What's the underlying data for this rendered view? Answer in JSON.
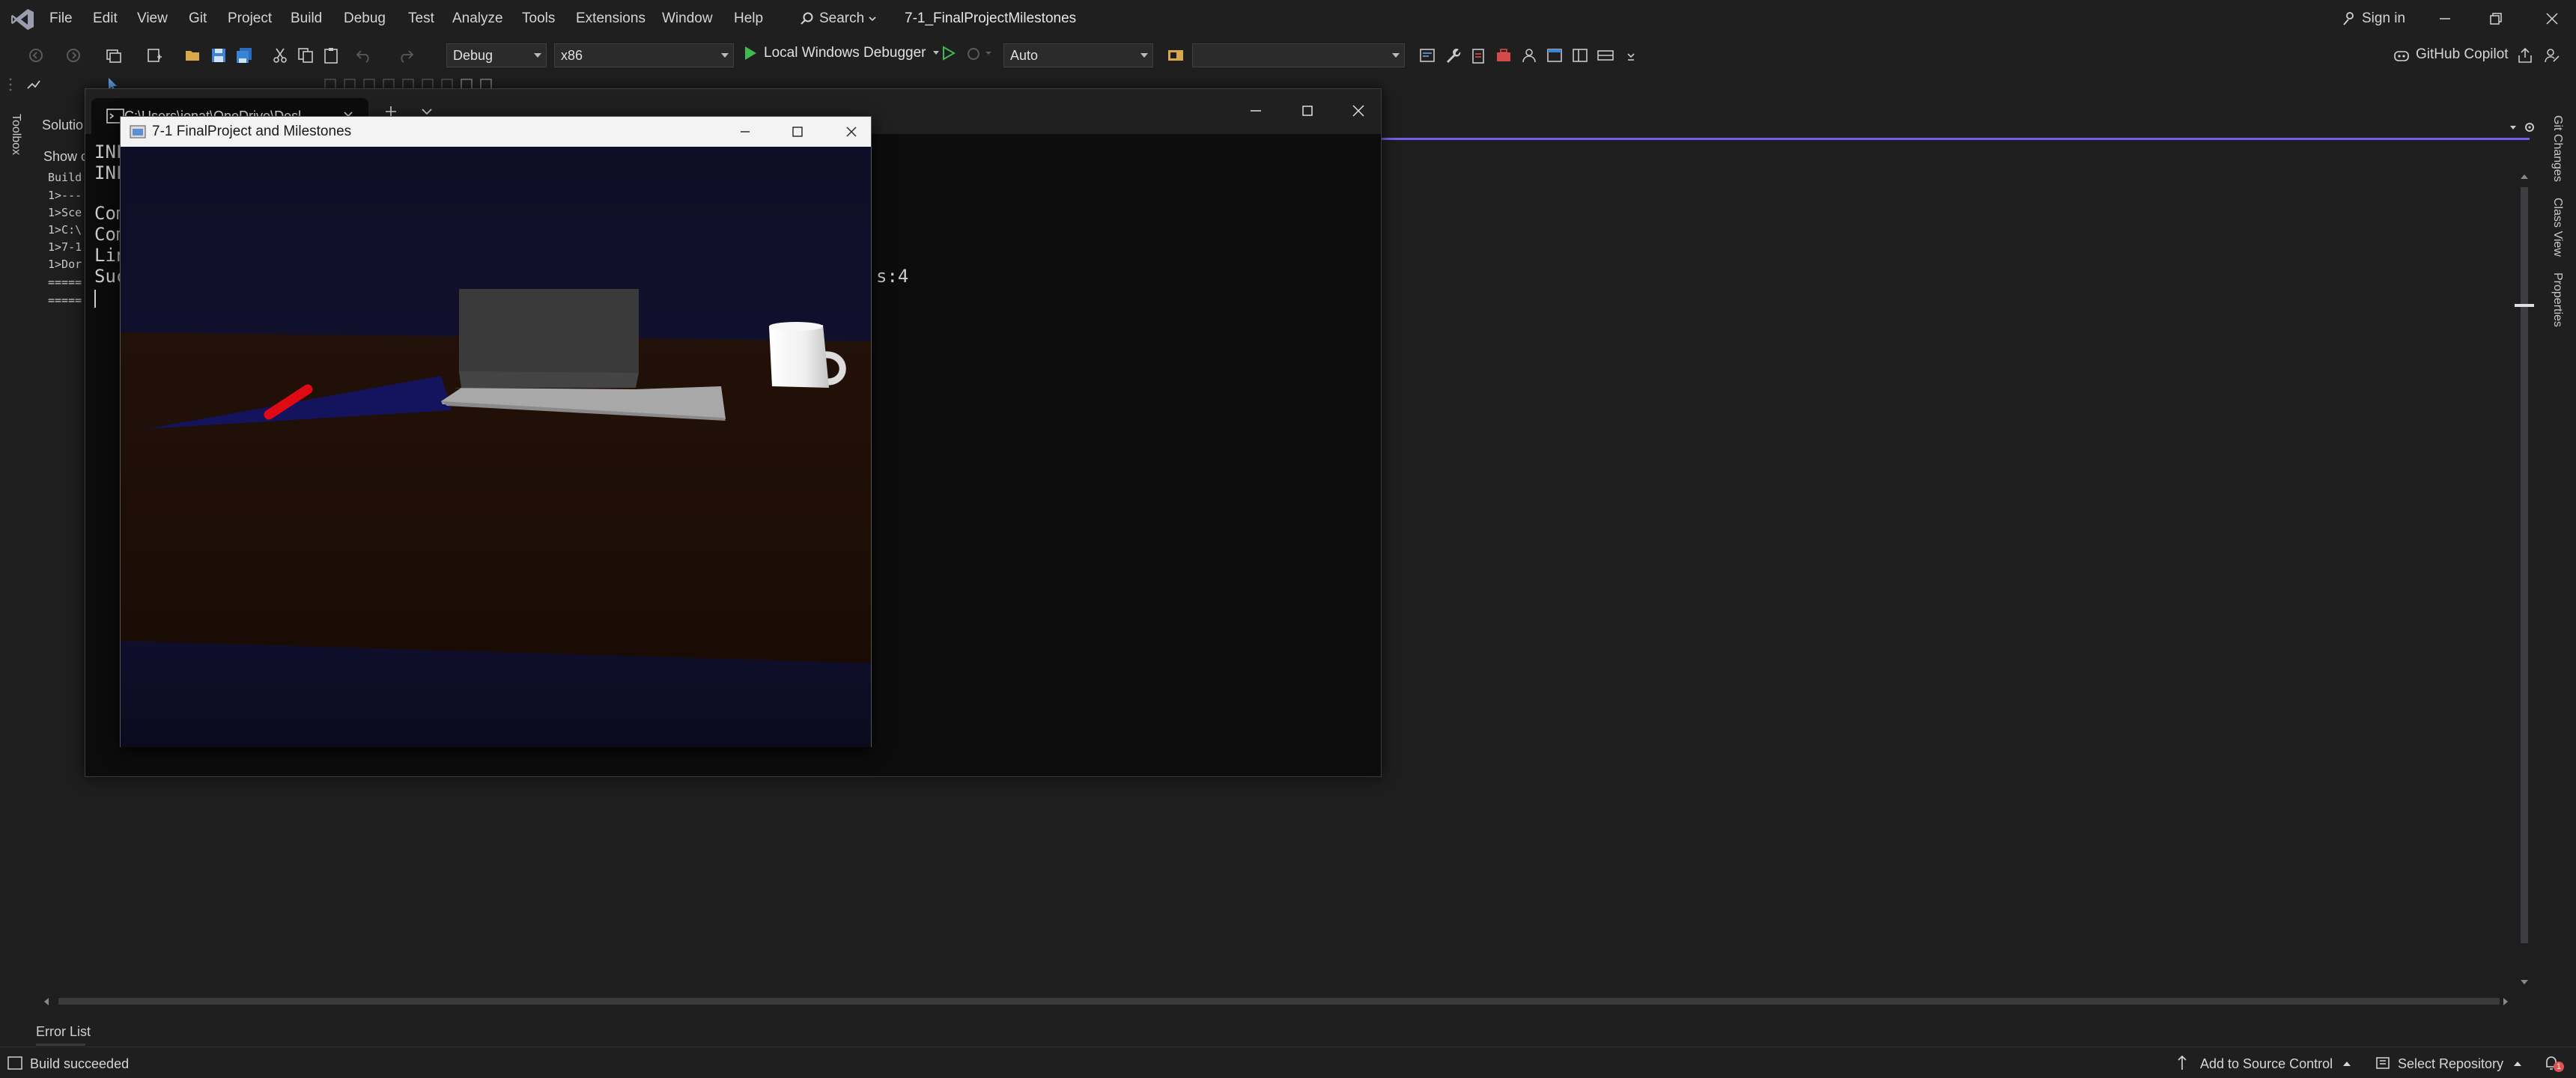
{
  "menu": {
    "items": [
      "File",
      "Edit",
      "View",
      "Git",
      "Project",
      "Build",
      "Debug",
      "Test",
      "Analyze",
      "Tools",
      "Extensions",
      "Window",
      "Help"
    ],
    "search_label": "Search",
    "solution_title": "7-1_FinalProjectMilestones",
    "sign_in": "Sign in"
  },
  "toolbar": {
    "configuration": "Debug",
    "platform": "x86",
    "debugger_label": "Local Windows Debugger",
    "stack_frame": "Auto",
    "copilot_label": "GitHub Copilot"
  },
  "side_panels": {
    "left": [
      "Toolbox"
    ],
    "right": [
      "Git Changes",
      "Class View",
      "Properties"
    ]
  },
  "solution_explorer": {
    "tab_label": "Solutio",
    "show_label": "Show c",
    "output_lines": [
      "Build",
      "1>---",
      "1>Sce",
      "1>C:\\",
      "1>7-1",
      "1>Dor",
      "=====",
      "====="
    ]
  },
  "console": {
    "tab_title": "C:\\Users\\jonat\\OneDrive\\Desl",
    "lines": [
      "INF",
      "INF",
      "",
      "Com",
      "Com",
      "Lin",
      "Suc"
    ],
    "partial_text": "s:4"
  },
  "gl_window": {
    "title": "7-1 FinalProject and Milestones"
  },
  "bottom": {
    "error_list_tab": "Error List"
  },
  "status": {
    "message": "Build succeeded",
    "source_control": "Add to Source Control",
    "repository": "Select Repository",
    "notification_count": "1"
  },
  "colors": {
    "accent": "#7160e8",
    "background": "#1f1f1f",
    "console_bg": "#0c0c0c",
    "play_green": "#3fb950"
  }
}
